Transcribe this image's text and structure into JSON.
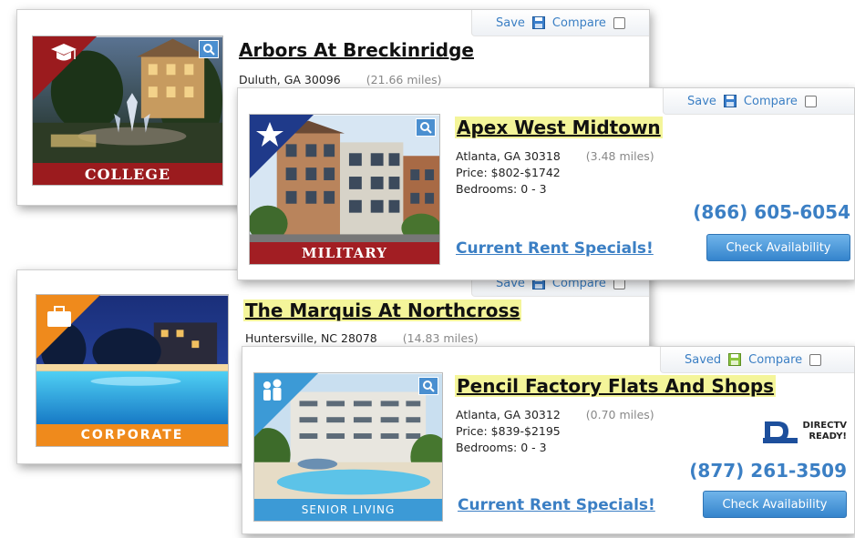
{
  "listings": [
    {
      "name": "Arbors At Breckinridge",
      "location": "Duluth, GA 30096",
      "distance": "(21.66 miles)",
      "badge": "COLLEGE",
      "badge_icon": "graduation-cap-icon",
      "save_label": "Save",
      "compare_label": "Compare"
    },
    {
      "name": "Apex West Midtown",
      "location": "Atlanta, GA 30318",
      "distance": "(3.48 miles)",
      "price": "Price: $802-$1742",
      "bedrooms": "Bedrooms: 0 - 3",
      "phone": "(866) 605-6054",
      "specials": "Current Rent Specials!",
      "check": "Check Availability",
      "badge": "MILITARY",
      "badge_icon": "star-icon",
      "save_label": "Save",
      "compare_label": "Compare"
    },
    {
      "name": "The Marquis At Northcross",
      "location": "Huntersville, NC 28078",
      "distance": "(14.83 miles)",
      "badge": "CORPORATE",
      "badge_icon": "briefcase-icon",
      "save_label": "Save",
      "compare_label": "Compare"
    },
    {
      "name": "Pencil Factory Flats And Shops",
      "location": "Atlanta, GA 30312",
      "distance": "(0.70 miles)",
      "price": "Price: $839-$2195",
      "bedrooms": "Bedrooms: 0 - 3",
      "phone": "(877) 261-3509",
      "specials": "Current Rent Specials!",
      "check": "Check Availability",
      "badge": "SENIOR LIVING",
      "badge_icon": "people-icon",
      "save_label": "Saved",
      "compare_label": "Compare",
      "directv_line1": "DIRECTV",
      "directv_line2": "READY!"
    }
  ],
  "colors": {
    "link": "#3b7fc4",
    "highlight": "#f4f59a",
    "college": "#9b1b1e",
    "military": "#a21e23",
    "corporate": "#ef8a1c",
    "senior": "#3c9ad6"
  }
}
